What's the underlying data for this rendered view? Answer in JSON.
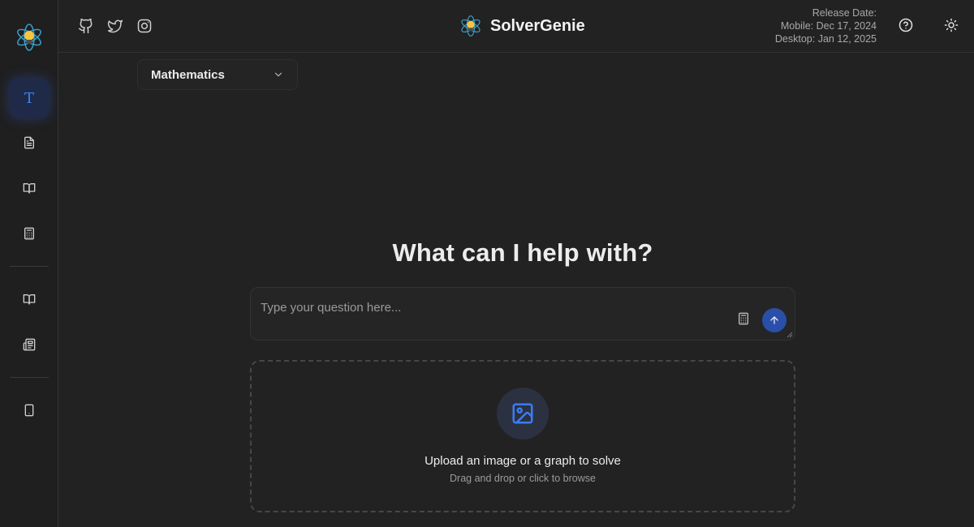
{
  "app": {
    "title": "SolverGenie"
  },
  "header": {
    "release": {
      "label": "Release Date:",
      "mobile": "Mobile: Dec 17, 2024",
      "desktop": "Desktop: Jan 12, 2025"
    },
    "social_icons": [
      "github-icon",
      "twitter-icon",
      "instagram-icon"
    ],
    "right_icons": [
      "help-icon",
      "theme-toggle-sun-icon"
    ]
  },
  "sidebar": {
    "items": [
      {
        "icon": "text-mode-icon",
        "active": true
      },
      {
        "icon": "document-icon",
        "active": false
      },
      {
        "icon": "book-open-icon",
        "active": false
      },
      {
        "icon": "calculator-icon",
        "active": false
      },
      {
        "icon": "book-open-icon",
        "active": false
      },
      {
        "icon": "newspaper-icon",
        "active": false
      },
      {
        "icon": "tablet-icon",
        "active": false
      }
    ]
  },
  "subject_select": {
    "value": "Mathematics"
  },
  "main": {
    "headline": "What can I help with?",
    "question": {
      "placeholder": "Type your question here...",
      "value": ""
    },
    "upload": {
      "title": "Upload an image or a graph to solve",
      "subtitle": "Drag and drop or click to browse"
    }
  },
  "colors": {
    "background": "#222222",
    "sidebar": "#1f1f1f",
    "accent": "#3b82f6",
    "send_button": "#2a4fa8"
  }
}
